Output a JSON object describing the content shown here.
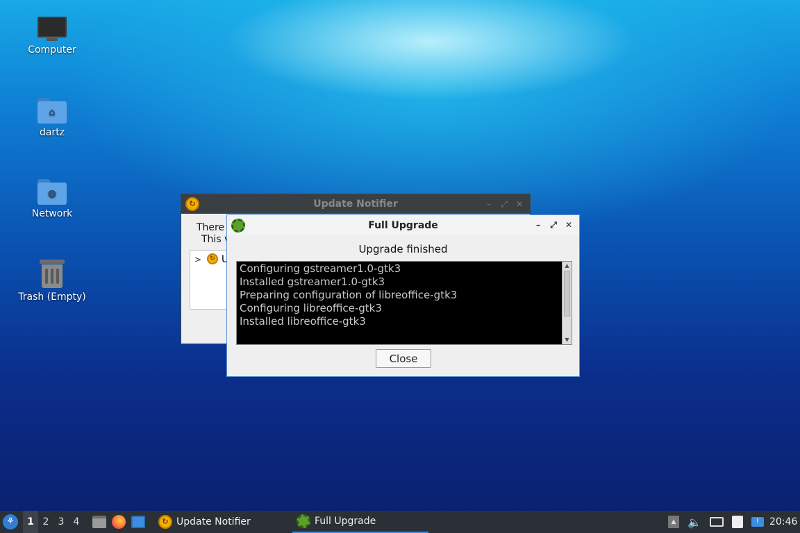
{
  "desktop": {
    "icons": [
      {
        "label": "Computer"
      },
      {
        "label": "dartz"
      },
      {
        "label": "Network"
      },
      {
        "label": "Trash (Empty)"
      }
    ]
  },
  "notifier_window": {
    "title": "Update Notifier",
    "text_line1": "There",
    "text_line2": "This v",
    "tree_item": "U"
  },
  "upgrade_window": {
    "title": "Full Upgrade",
    "status": "Upgrade finished",
    "log": [
      "Configuring gstreamer1.0-gtk3",
      "Installed gstreamer1.0-gtk3",
      "Preparing configuration of libreoffice-gtk3",
      "Configuring libreoffice-gtk3",
      "Installed libreoffice-gtk3"
    ],
    "close_label": "Close"
  },
  "taskbar": {
    "workspaces": [
      "1",
      "2",
      "3",
      "4"
    ],
    "active_workspace": "1",
    "tasks": [
      {
        "label": "Update Notifier"
      },
      {
        "label": "Full Upgrade"
      }
    ],
    "clock": "20:46"
  },
  "colors": {
    "accent": "#3d8ee0",
    "taskbar_bg": "#2b3036"
  }
}
